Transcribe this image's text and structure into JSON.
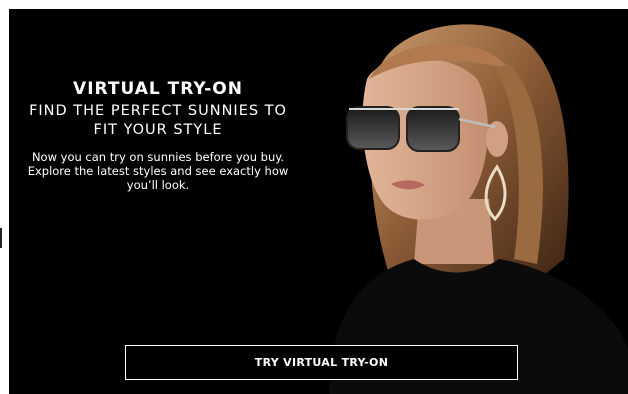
{
  "promo": {
    "title": "VIRTUAL TRY-ON",
    "subtitle": "FIND THE PERFECT SUNNIES TO FIT YOUR STYLE",
    "body": "Now you can try on sunnies before you buy. Explore the latest styles and see exactly how you’ll look.",
    "cta_label": "TRY VIRTUAL TRY-ON"
  },
  "colors": {
    "background": "#000000",
    "text": "#ffffff",
    "button_border": "#ffffff"
  }
}
